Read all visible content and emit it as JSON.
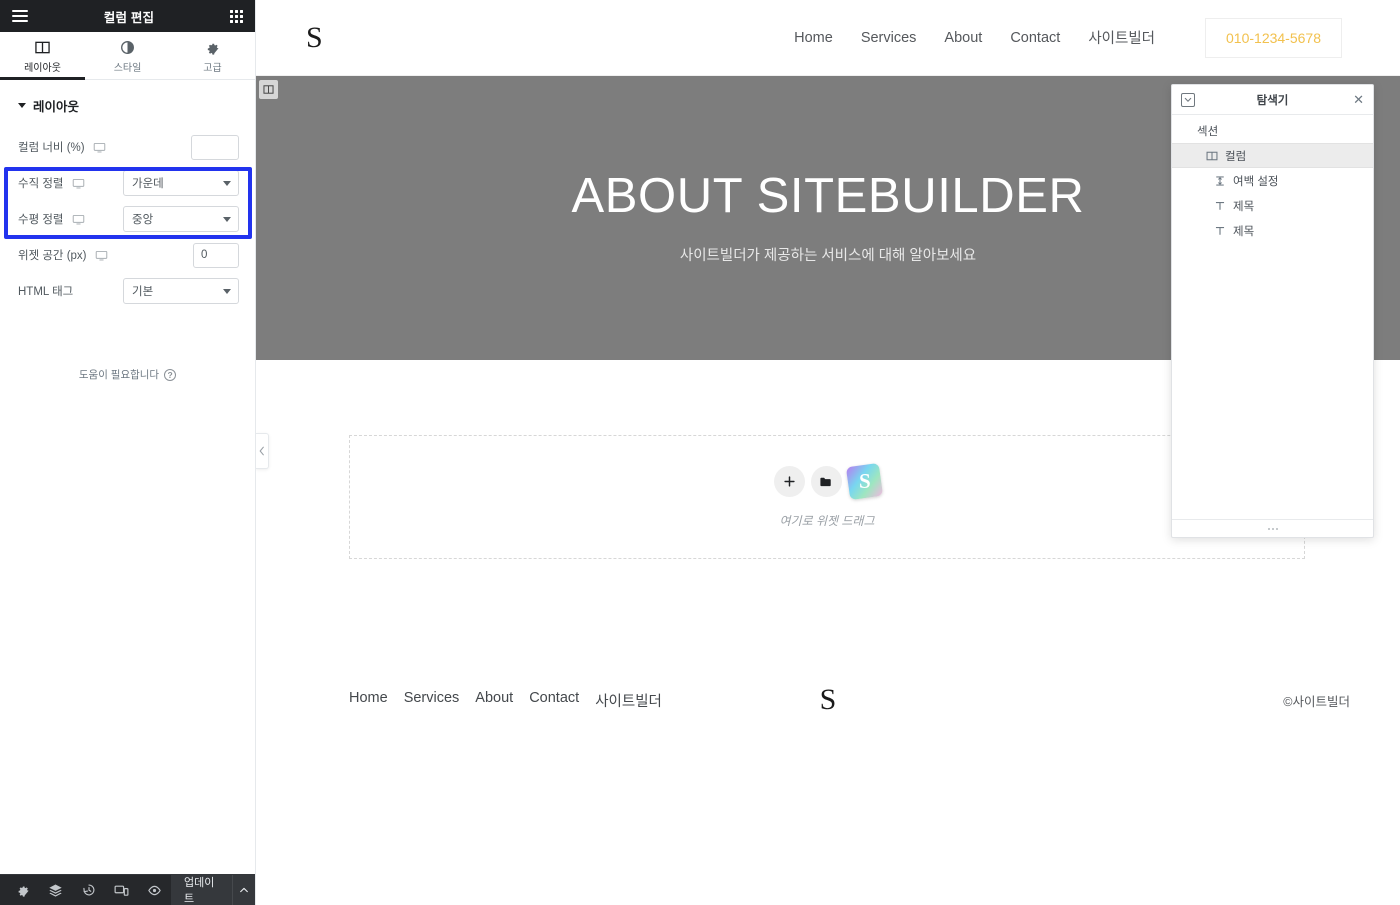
{
  "panel": {
    "header": {
      "title": "컬럼 편집",
      "menu_icon": "hamburger-icon",
      "widgets_icon": "grid-icon"
    },
    "tabs": [
      {
        "label": "레이아웃",
        "icon": "columns-icon",
        "active": true
      },
      {
        "label": "스타일",
        "icon": "contrast-icon",
        "active": false
      },
      {
        "label": "고급",
        "icon": "gear-icon",
        "active": false
      }
    ],
    "section": {
      "title": "레이아웃",
      "collapsed": false
    },
    "controls": [
      {
        "label": "컬럼 너비 (%)",
        "type": "text",
        "value": "",
        "device_icon": "desktop-icon",
        "highlighted": false
      },
      {
        "label": "수직 정렬",
        "type": "select",
        "value": "가운데",
        "device_icon": "desktop-icon",
        "highlighted": true
      },
      {
        "label": "수평 정렬",
        "type": "select",
        "value": "중앙",
        "device_icon": "desktop-icon",
        "highlighted": true
      },
      {
        "label": "위젯 공간 (px)",
        "type": "text",
        "value": "0",
        "device_icon": "desktop-icon",
        "highlighted": false
      },
      {
        "label": "HTML 태그",
        "type": "select",
        "value": "기본",
        "device_icon": "",
        "highlighted": false
      }
    ],
    "help": {
      "label": "도움이 필요합니다",
      "icon": "question-circle-icon"
    },
    "footer": {
      "icons": [
        "settings-icon",
        "layers-icon",
        "history-icon",
        "responsive-icon",
        "preview-icon"
      ],
      "update_label": "업데이트",
      "caret_icon": "chevron-up-icon"
    },
    "highlight_color": "#2233ee"
  },
  "canvas": {
    "site_header": {
      "logo": "S",
      "nav": [
        "Home",
        "Services",
        "About",
        "Contact",
        "사이트빌더"
      ],
      "phone": "010-1234-5678",
      "phone_color": "#f2c14e"
    },
    "hero": {
      "title": "ABOUT SITEBUILDER",
      "subtitle": "사이트빌더가 제공하는 서비스에 대해 알아보세요",
      "background_color": "#7d7d7d",
      "handle_icon": "column-handle-icon"
    },
    "drop_area": {
      "text": "여기로 위젯 드래그",
      "buttons": [
        {
          "icon": "plus-icon",
          "name": "add-widget-button"
        },
        {
          "icon": "folder-icon",
          "name": "add-template-button"
        },
        {
          "icon": "sitebuilder-s-icon",
          "name": "sitebuilder-button"
        }
      ]
    },
    "site_footer": {
      "nav": [
        "Home",
        "Services",
        "About",
        "Contact",
        "사이트빌더"
      ],
      "logo": "S",
      "copyright": "©사이트빌더"
    },
    "collapse_handle_icon": "chevron-left-icon"
  },
  "navigator": {
    "title": "탐색기",
    "dock_icon": "dock-icon",
    "close_icon": "close-icon",
    "tree": [
      {
        "label": "섹션",
        "level": 0,
        "icon": "",
        "caret": true,
        "selected": false
      },
      {
        "label": "컬럼",
        "level": 1,
        "icon": "columns-icon",
        "caret": true,
        "selected": true
      },
      {
        "label": "여백 설정",
        "level": 2,
        "icon": "spacer-icon",
        "caret": false,
        "selected": false
      },
      {
        "label": "제목",
        "level": 2,
        "icon": "heading-icon",
        "caret": false,
        "selected": false
      },
      {
        "label": "제목",
        "level": 2,
        "icon": "heading-icon",
        "caret": false,
        "selected": false
      }
    ],
    "resize_grip_icon": "grip-dots-icon"
  }
}
